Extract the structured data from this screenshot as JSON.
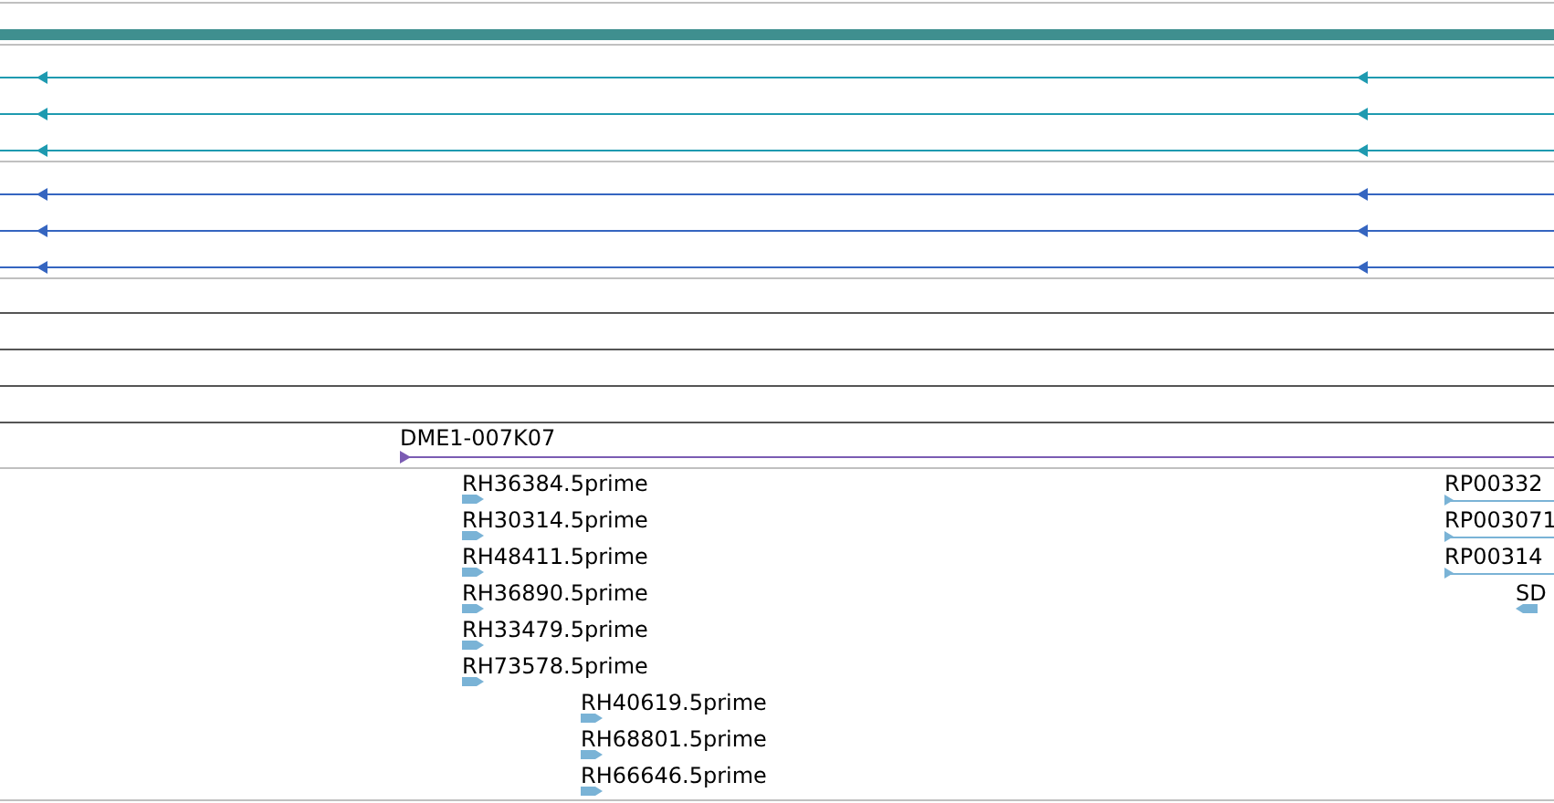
{
  "tracks": [
    {
      "kind": "bar",
      "color": "#3f8f8f"
    },
    {
      "kind": "lines",
      "color": "#1e9ab0",
      "rows": [
        {
          "arrow": true,
          "reverse": true
        },
        {
          "arrow": true,
          "reverse": true
        },
        {
          "arrow": true,
          "reverse": true
        }
      ]
    },
    {
      "kind": "lines",
      "color": "#3565c0",
      "rows": [
        {
          "arrow": true,
          "reverse": true
        },
        {
          "arrow": true,
          "reverse": true
        },
        {
          "arrow": true,
          "reverse": true
        }
      ]
    },
    {
      "kind": "lines",
      "color": "#555555",
      "rows": [
        {
          "arrow": false
        },
        {
          "arrow": false
        },
        {
          "arrow": false
        },
        {
          "arrow": false
        }
      ]
    },
    {
      "kind": "clone",
      "label": "DME1-007K07",
      "color": "#7b5cb3",
      "reverse": false
    },
    {
      "kind": "ests",
      "color": "#7ab3d6",
      "items": [
        {
          "label": "RH36384.5prime",
          "reverse": false,
          "kind": "block"
        },
        {
          "label": "RH30314.5prime",
          "reverse": false,
          "kind": "block"
        },
        {
          "label": "RH48411.5prime",
          "reverse": false,
          "kind": "block"
        },
        {
          "label": "RH36890.5prime",
          "reverse": false,
          "kind": "block"
        },
        {
          "label": "RH33479.5prime",
          "reverse": false,
          "kind": "block"
        },
        {
          "label": "RH73578.5prime",
          "reverse": false,
          "kind": "block"
        },
        {
          "label": "RH40619.5prime",
          "reverse": false,
          "kind": "block"
        },
        {
          "label": "RH68801.5prime",
          "reverse": false,
          "kind": "block"
        },
        {
          "label": "RH66646.5prime",
          "reverse": false,
          "kind": "block"
        },
        {
          "label": "RP00332",
          "reverse": false,
          "kind": "line"
        },
        {
          "label": "RP003071",
          "reverse": false,
          "kind": "line"
        },
        {
          "label": "RP00314",
          "reverse": false,
          "kind": "line"
        },
        {
          "label": "SD",
          "reverse": true,
          "kind": "block"
        }
      ]
    }
  ]
}
